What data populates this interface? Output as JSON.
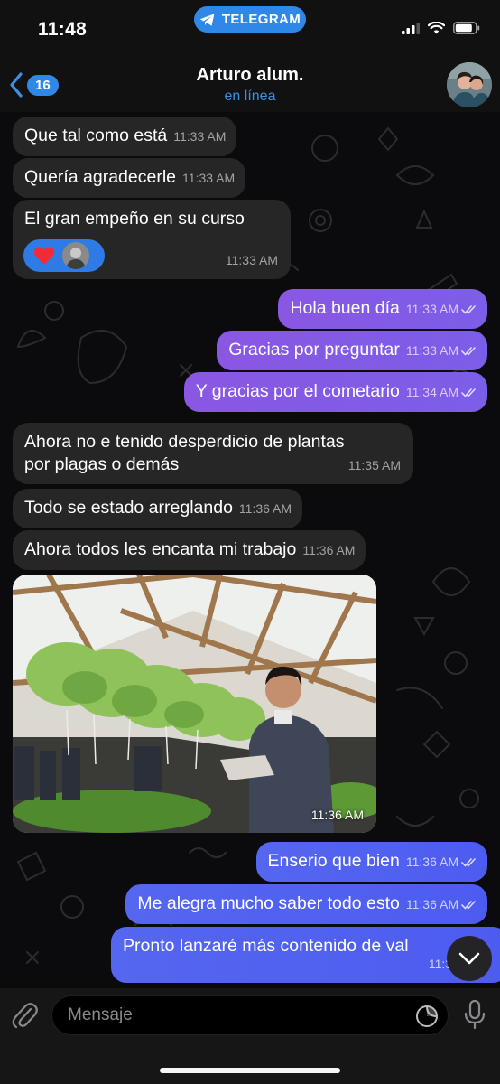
{
  "status_bar": {
    "time": "11:48",
    "app_badge": "TELEGRAM"
  },
  "header": {
    "back_count": "16",
    "title": "Arturo alum.",
    "status": "en línea"
  },
  "messages": [
    {
      "text": "Que tal como está",
      "time": "11:33 AM"
    },
    {
      "text": "Quería agradecerle",
      "time": "11:33 AM"
    },
    {
      "text": "El gran empeño en su curso",
      "time": "11:33 AM",
      "reaction": "❤️"
    },
    {
      "text": "Hola buen día",
      "time": "11:33 AM"
    },
    {
      "text": "Gracias por preguntar",
      "time": "11:33 AM"
    },
    {
      "text": "Y gracias por el cometario",
      "time": "11:34 AM"
    },
    {
      "text": "Ahora no e tenido desperdicio de plantas",
      "text2": "por plagas o demás",
      "time": "11:35 AM"
    },
    {
      "text": "Todo se estado arreglando",
      "time": "11:36 AM"
    },
    {
      "text": "Ahora todos les encanta mi trabajo",
      "time": "11:36 AM"
    },
    {
      "time": "11:36 AM"
    },
    {
      "text": "Enserio que bien",
      "time": "11:36 AM"
    },
    {
      "text": "Me alegra mucho saber todo esto",
      "time": "11:36 AM"
    },
    {
      "text": "Pronto lanzaré más contenido de val",
      "time": "11:38 AM"
    }
  ],
  "input": {
    "placeholder": "Mensaje"
  },
  "colors": {
    "accent": "#2f88e8",
    "outgoing_purple": "#8a57e3",
    "outgoing_blue": "#5566f0",
    "incoming": "#262626"
  },
  "icons": [
    "telegram-icon",
    "signal-icon",
    "wifi-icon",
    "battery-icon",
    "back-chevron-icon",
    "heart-icon",
    "double-check-icon",
    "chevron-down-icon",
    "paperclip-icon",
    "sticker-icon",
    "microphone-icon"
  ]
}
